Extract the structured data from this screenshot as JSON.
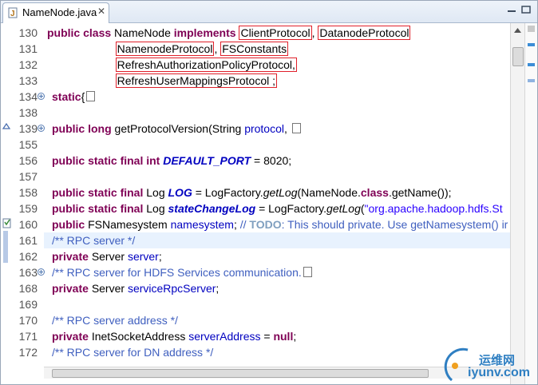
{
  "tab": {
    "title": "NameNode.java",
    "close": "✕"
  },
  "lines": [
    {
      "n": "130",
      "parts": [
        [
          "kw",
          "public class "
        ],
        [
          "",
          "NameNode "
        ],
        [
          "kw",
          "implements "
        ],
        [
          "box",
          "ClientProtocol"
        ],
        [
          "",
          ", "
        ],
        [
          "box",
          "DatanodeProtocol"
        ]
      ]
    },
    {
      "n": "131",
      "parts": [
        [
          "",
          "                      "
        ],
        [
          "box",
          "NamenodeProtocol"
        ],
        [
          "",
          ", "
        ],
        [
          "box",
          "FSConstants"
        ]
      ]
    },
    {
      "n": "132",
      "parts": [
        [
          "",
          "                      "
        ],
        [
          "box",
          "RefreshAuthorizationPolicyProtocol,"
        ]
      ]
    },
    {
      "n": "133",
      "parts": [
        [
          "",
          "                      "
        ],
        [
          "box",
          "RefreshUserMappingsProtocol ;"
        ]
      ]
    },
    {
      "n": "134",
      "parts": [
        [
          "",
          ""
        ],
        [
          "kw",
          "static"
        ],
        [
          "",
          "{"
        ]
      ]
    },
    {
      "n": "138",
      "parts": []
    },
    {
      "n": "139",
      "parts": [
        [
          "kw",
          "public long "
        ],
        [
          "",
          "getProtocolVersion(String "
        ],
        [
          "fld",
          "protocol"
        ],
        [
          "",
          ", "
        ]
      ]
    },
    {
      "n": "155",
      "parts": []
    },
    {
      "n": "156",
      "parts": [
        [
          "kw",
          "public static final int "
        ],
        [
          "cst",
          "DEFAULT_PORT"
        ],
        [
          "",
          " = 8020;"
        ]
      ]
    },
    {
      "n": "157",
      "parts": []
    },
    {
      "n": "158",
      "parts": [
        [
          "kw",
          "public static final "
        ],
        [
          "",
          "Log "
        ],
        [
          "cst",
          "LOG"
        ],
        [
          "",
          " = LogFactory."
        ],
        [
          "it",
          "getLog"
        ],
        [
          "",
          "(NameNode."
        ],
        [
          "kw",
          "class"
        ],
        [
          "",
          ".getName());"
        ]
      ]
    },
    {
      "n": "159",
      "parts": [
        [
          "kw",
          "public static final "
        ],
        [
          "",
          "Log "
        ],
        [
          "cst",
          "stateChangeLog"
        ],
        [
          "",
          " = LogFactory."
        ],
        [
          "it",
          "getLog"
        ],
        [
          "",
          "("
        ],
        [
          "str",
          "\"org.apache.hadoop.hdfs.St"
        ]
      ]
    },
    {
      "n": "160",
      "parts": [
        [
          "kw",
          "public "
        ],
        [
          "",
          "FSNamesystem "
        ],
        [
          "fld",
          "namesystem"
        ],
        [
          "",
          "; "
        ],
        [
          "cm",
          "// "
        ],
        [
          "todo",
          "TODO"
        ],
        [
          "cm",
          ": This should private. Use getNamesystem() ir"
        ]
      ]
    },
    {
      "n": "161",
      "parts": [
        [
          "cm",
          "/** RPC server */"
        ]
      ]
    },
    {
      "n": "162",
      "parts": [
        [
          "kw",
          "private "
        ],
        [
          "",
          "Server "
        ],
        [
          "fld",
          "server"
        ],
        [
          "",
          ";"
        ]
      ]
    },
    {
      "n": "163",
      "parts": [
        [
          "cm",
          "/** RPC server for HDFS Services communication."
        ]
      ]
    },
    {
      "n": "168",
      "parts": [
        [
          "kw",
          "private "
        ],
        [
          "",
          "Server "
        ],
        [
          "fld",
          "serviceRpcServer"
        ],
        [
          "",
          ";"
        ]
      ]
    },
    {
      "n": "169",
      "parts": []
    },
    {
      "n": "170",
      "parts": [
        [
          "cm",
          "/** RPC server address */"
        ]
      ]
    },
    {
      "n": "171",
      "parts": [
        [
          "kw",
          "private "
        ],
        [
          "",
          "InetSocketAddress "
        ],
        [
          "fld",
          "serverAddress"
        ],
        [
          "",
          " = "
        ],
        [
          "kw",
          "null"
        ],
        [
          "",
          ";"
        ]
      ]
    },
    {
      "n": "172",
      "parts": [
        [
          "cm",
          "/** RPC server for DN address */"
        ]
      ]
    }
  ],
  "watermark": {
    "cn": "运维网",
    "en": "iyunv.com"
  }
}
